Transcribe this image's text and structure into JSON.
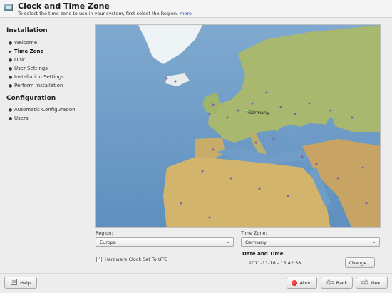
{
  "window": {
    "title": "Clock and Time Zone",
    "subtitle": "To select the time zone to use in your system, first select the Region.",
    "more_link": "more",
    "icon": "clock-app-icon"
  },
  "sidebar": {
    "installation_title": "Installation",
    "installation_steps": [
      {
        "label": "Welcome",
        "current": false
      },
      {
        "label": "Time Zone",
        "current": true
      },
      {
        "label": "Disk",
        "current": false
      },
      {
        "label": "User Settings",
        "current": false
      },
      {
        "label": "Installation Settings",
        "current": false
      },
      {
        "label": "Perform Installation",
        "current": false
      }
    ],
    "configuration_title": "Configuration",
    "configuration_steps": [
      {
        "label": "Automatic Configuration",
        "current": false
      },
      {
        "label": "Users",
        "current": false
      }
    ]
  },
  "map": {
    "selected_label": "Germany"
  },
  "region": {
    "label": "Region:",
    "value": "Europe"
  },
  "timezone": {
    "label": "Time Zone:",
    "value": "Germany"
  },
  "hardware_clock": {
    "label": "Hardware Clock Set To UTC",
    "checked": true
  },
  "datetime": {
    "title": "Date and Time",
    "value": "2011-11-16 - 13:42:38",
    "change_button": "Change..."
  },
  "buttons": {
    "help": "Help",
    "abort": "Abort",
    "back": "Back",
    "next": "Next"
  },
  "colors": {
    "ocean": "#6f9dc8",
    "land": "#c9b07a",
    "selection": "#2a5da8"
  }
}
